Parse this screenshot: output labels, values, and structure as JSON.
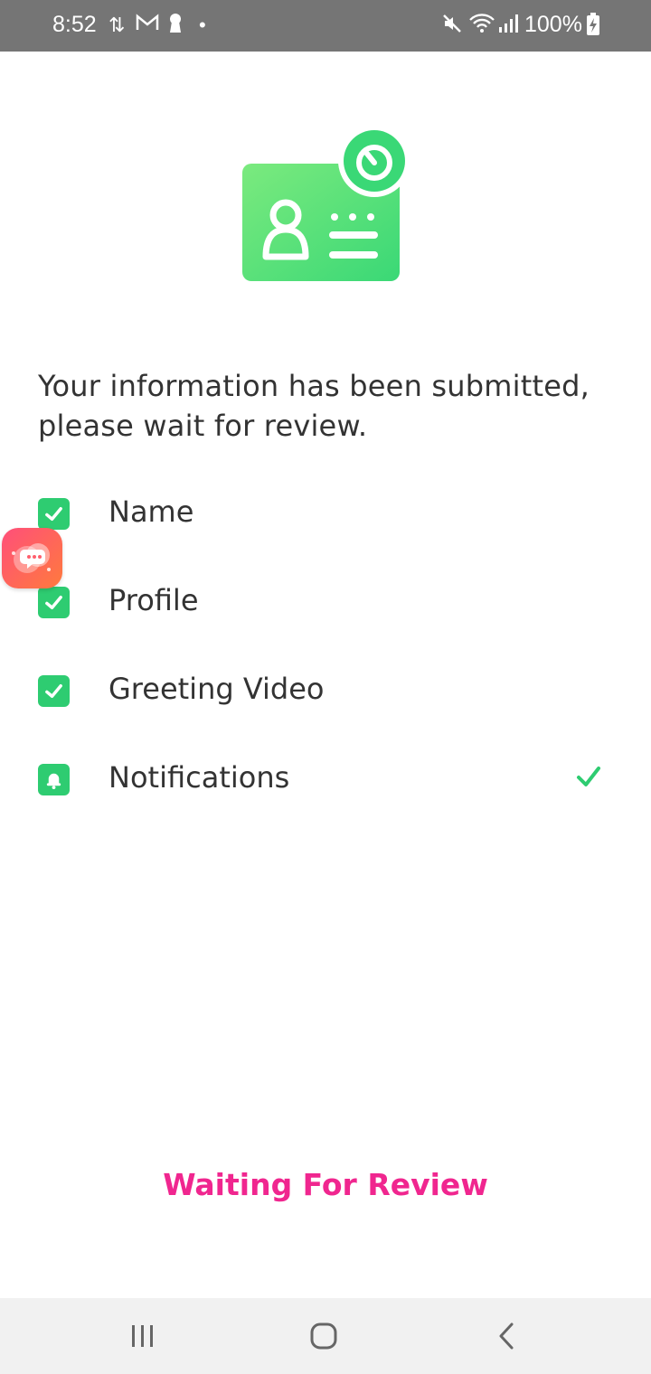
{
  "status_bar": {
    "time": "8:52",
    "battery": "100%",
    "icons": [
      "data-transfer-icon",
      "gmail-icon",
      "keyhole-icon",
      "dot-icon",
      "mute-icon",
      "wifi-icon",
      "signal-icon",
      "battery-charging-icon"
    ]
  },
  "hero": {
    "icon": "id-card-timer-icon",
    "accent": "#2ecc71"
  },
  "message": "Your information has been submitted, please wait for review.",
  "checklist": [
    {
      "label": "Name",
      "icon": "checkbox-checked-icon"
    },
    {
      "label": "Profile",
      "icon": "checkbox-checked-icon"
    },
    {
      "label": "Greeting Video",
      "icon": "checkbox-checked-icon"
    },
    {
      "label": "Notifications",
      "icon": "bell-icon",
      "trailing": "checkmark-icon"
    }
  ],
  "floating_bubble": {
    "icon": "chat-bubble-icon"
  },
  "action": {
    "label": "Waiting For Review",
    "color": "#f0268f"
  },
  "nav": {
    "icons": [
      "recent-apps-icon",
      "home-icon",
      "back-icon"
    ]
  }
}
